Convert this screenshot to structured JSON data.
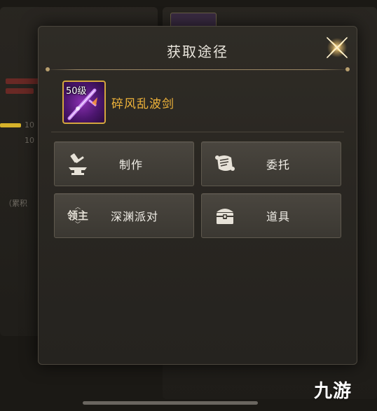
{
  "modal": {
    "title": "获取途径",
    "item": {
      "level": "50级",
      "name": "碎风乱波剑",
      "rarity_color": "#f0b43a"
    },
    "sources": [
      {
        "label": "制作",
        "icon": "anvil-icon"
      },
      {
        "label": "委托",
        "icon": "scroll-icon"
      },
      {
        "label": "深渊派对",
        "icon": "lord-badge-icon",
        "icon_text": "领主"
      },
      {
        "label": "道具",
        "icon": "treasure-chest-icon"
      }
    ]
  },
  "background": {
    "numbers": [
      "10",
      "10"
    ],
    "side_text": "（累积"
  },
  "watermark": "九游",
  "colors": {
    "accent_gold": "#d4a63e",
    "title_text": "#e9e5dc",
    "button_bg": "#433f38"
  }
}
